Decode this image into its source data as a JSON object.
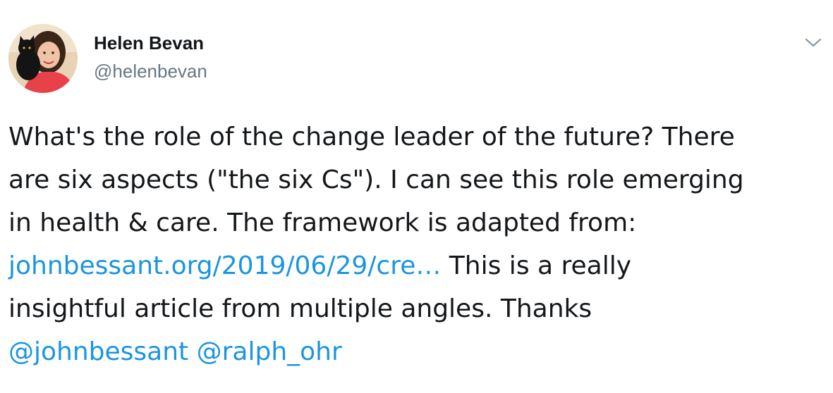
{
  "author": {
    "name": "Helen Bevan",
    "handle": "@helenbevan"
  },
  "icons": {
    "menu": "chevron-down-icon",
    "avatar": "profile-photo-woman-with-black-cat"
  },
  "colors": {
    "text": "#14171a",
    "handle": "#657786",
    "link": "#1b95e0",
    "caret": "#8899a6"
  },
  "tweet": {
    "line1": "What's the role of the change leader of the future? There",
    "line2": "are six aspects (\"the six Cs\"). I can see this role emerging",
    "line3": "in health & care. The framework is adapted from:",
    "link_url_text": "johnbessant.org/2019/06/29/cre…",
    "line4_rest": " This is a really",
    "line5": "insightful article from multiple angles. Thanks",
    "mention1": "@johnbessant",
    "mention2": "@ralph_ohr"
  }
}
